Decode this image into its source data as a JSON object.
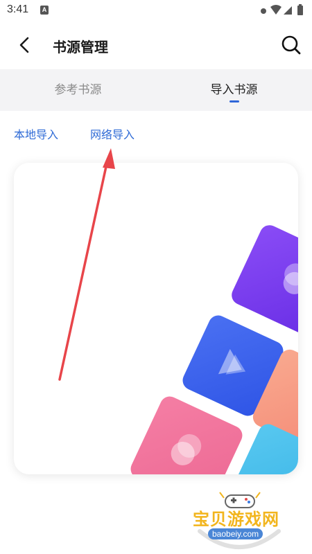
{
  "status_bar": {
    "time": "3:41",
    "notification_badge": "A",
    "icons": [
      "settings-dot-icon",
      "wifi-icon",
      "cellular-signal-icon",
      "battery-icon"
    ]
  },
  "header": {
    "title": "书源管理",
    "back_icon": "back-chevron-icon",
    "search_icon": "search-icon"
  },
  "tabs": [
    {
      "label": "参考书源",
      "active": false
    },
    {
      "label": "导入书源",
      "active": true
    }
  ],
  "import_options": {
    "local_label": "本地导入",
    "network_label": "网络导入"
  },
  "illustration": {
    "tiles": [
      "purple-tile",
      "blue-play-tile",
      "pink-tile",
      "orange-tile",
      "cyan-tile"
    ]
  },
  "watermark": {
    "title": "宝贝游戏网",
    "url": "baobeiy.com"
  },
  "colors": {
    "accent": "#2f66d8",
    "link": "#2f6bd6",
    "tab_bg": "#f3f3f5",
    "annotation_arrow": "#e8454a",
    "tile_purple": "#7d3cf2",
    "tile_blue": "#3d63ee",
    "tile_pink": "#f0739c",
    "tile_orange": "#f79a84",
    "tile_cyan": "#46bdeb"
  }
}
